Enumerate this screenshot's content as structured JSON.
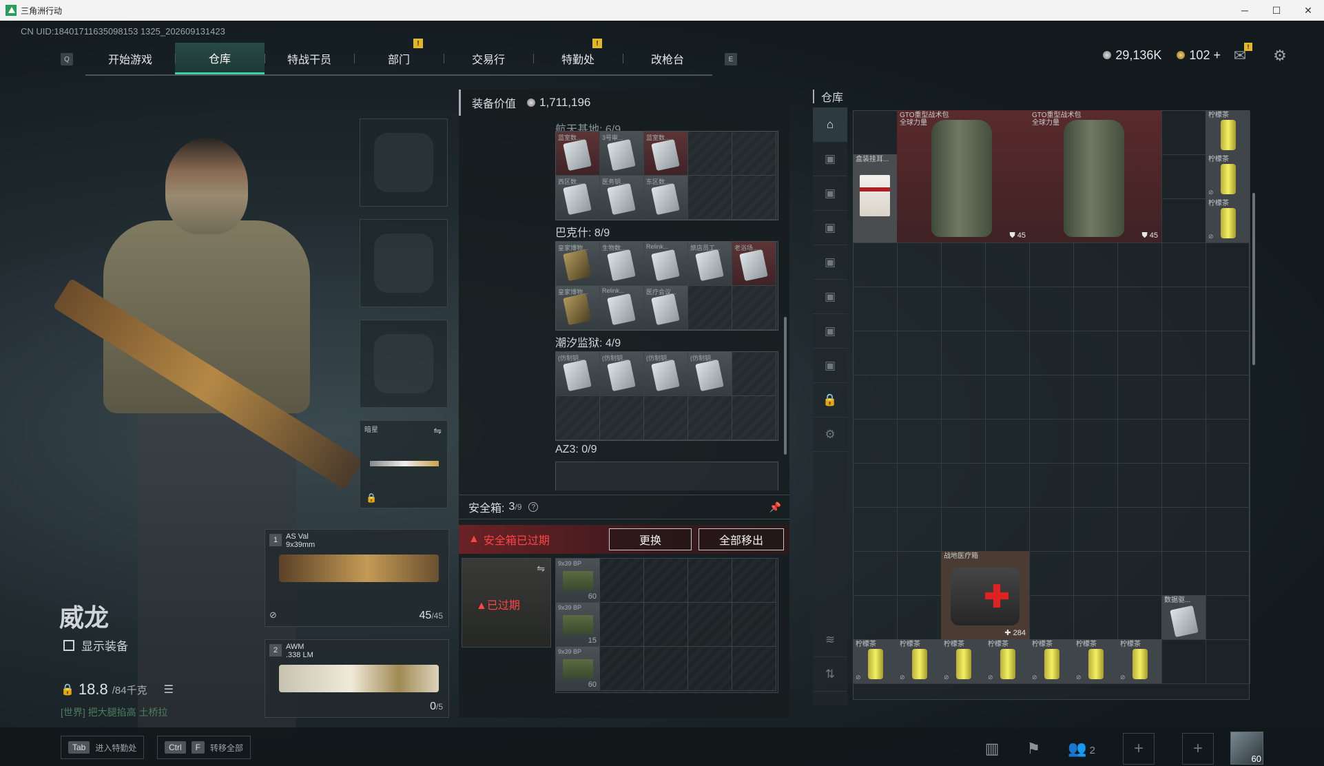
{
  "window": {
    "title": "三角洲行动",
    "controls": [
      "─",
      "☐",
      "✕"
    ]
  },
  "uid": "CN UID:18401711635098153 1325_202609131423",
  "nav": {
    "left_key": "Q",
    "right_key": "E",
    "tabs": [
      {
        "label": "开始游戏"
      },
      {
        "label": "仓库",
        "active": true
      },
      {
        "label": "特战干员"
      },
      {
        "label": "部门",
        "badge": "!"
      },
      {
        "label": "交易行"
      },
      {
        "label": "特勤处",
        "badge": "!"
      },
      {
        "label": "改枪台"
      }
    ]
  },
  "currency": {
    "silver": "29,136K",
    "gold": "102",
    "gold_plus": "+",
    "mail_badge": "!"
  },
  "character": {
    "name": "威龙",
    "show_equipment": "显示装备",
    "weight": "18.8",
    "weight_max": "/84千克",
    "world_msg": "[世界] 把大腿掐高 土桥拉"
  },
  "melee": {
    "label": "暗星"
  },
  "weapons": [
    {
      "slot": "1",
      "name": "AS Val",
      "caliber": "9x39mm",
      "ammo": "45",
      "ammo_max": "/45"
    },
    {
      "slot": "2",
      "name": "AWM",
      "caliber": ".338 LM",
      "ammo": "0",
      "ammo_max": "/5"
    }
  ],
  "equipment": {
    "value_label": "装备价值",
    "value": "1,711,196",
    "sections": [
      {
        "title": "航天基地: 6/9",
        "items": [
          "蓝室数...",
          "3号审...",
          "蓝室数...",
          "西区数...",
          "医务钥...",
          "东区数..."
        ]
      },
      {
        "title": "巴克什: 8/9",
        "items": [
          "皇家博物...",
          "生物数...",
          "Relink...",
          "旅店员工...",
          "老浴场...",
          "皇家博物...",
          "Relink...",
          "医疗会议..."
        ]
      },
      {
        "title": "潮汐监狱: 4/9",
        "items": [
          "(仿制钥...",
          "(仿制钥...",
          "(仿制钥...",
          "(仿制钥..."
        ]
      },
      {
        "title": "AZ3: 0/9",
        "items": []
      }
    ]
  },
  "safebox": {
    "label": "安全箱:",
    "count": "3",
    "capacity": "/9",
    "help": "?",
    "expired_warning": "安全箱已过期",
    "replace_button": "更换",
    "remove_all_button": "全部移出",
    "case_status": "已过期",
    "ammo": [
      {
        "label": "9x39 BP",
        "count": "60"
      },
      {
        "label": "9x39 BP",
        "count": "15"
      },
      {
        "label": "9x39 BP",
        "count": "60"
      }
    ]
  },
  "storage": {
    "title": "仓库",
    "items": {
      "coffee": "盒装挂耳...",
      "backpack_a": {
        "label": "GTO重型战术包",
        "sub": "全球力量",
        "count": "45"
      },
      "backpack_b": {
        "label": "GTO重型战术包",
        "sub": "全球力量",
        "count": "45"
      },
      "tea": "柠檬茶",
      "medkit": {
        "label": "战地医疗箱",
        "count": "284"
      },
      "data_drive": "数据驱..."
    }
  },
  "bottom": {
    "hint_tab": "Tab",
    "hint_tab_text": "进入特勤处",
    "hint_ctrl": "Ctrl",
    "hint_f": "F",
    "hint_transfer": "转移全部",
    "friends_count": "2",
    "level": "60"
  }
}
